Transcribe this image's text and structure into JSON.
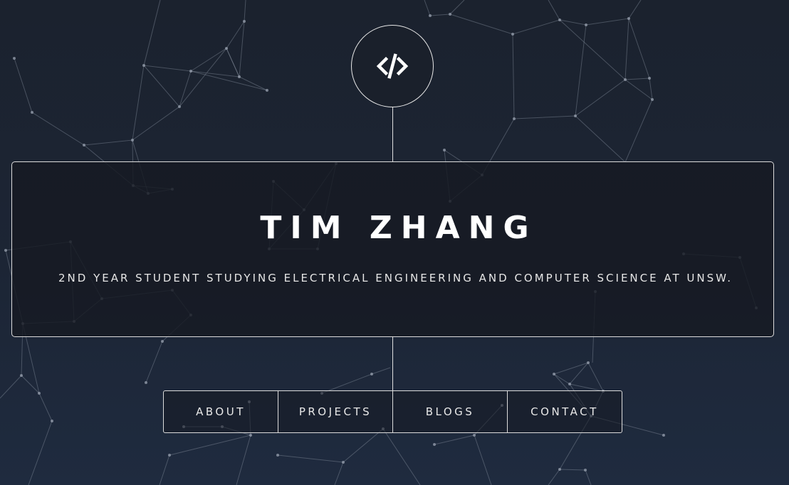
{
  "logo": {
    "icon": "code-icon"
  },
  "hero": {
    "name": "TIM ZHANG",
    "tagline": "2ND YEAR STUDENT STUDYING ELECTRICAL ENGINEERING AND COMPUTER SCIENCE AT UNSW."
  },
  "nav": {
    "items": [
      {
        "label": "ABOUT"
      },
      {
        "label": "PROJECTS"
      },
      {
        "label": "BLOGS"
      },
      {
        "label": "CONTACT"
      }
    ]
  },
  "colors": {
    "background": "#1c2535",
    "card": "#161a22",
    "border": "#dcdcdc",
    "text": "#ffffff",
    "network_lines": "#8a93a3"
  }
}
